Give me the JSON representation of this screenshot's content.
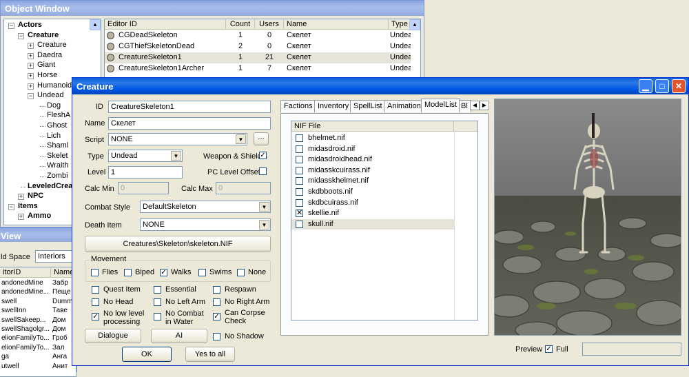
{
  "object_window": {
    "title": "Object Window",
    "tree": [
      {
        "label": "Actors",
        "level": 0,
        "sign": "-",
        "bold": true
      },
      {
        "label": "Creature",
        "level": 1,
        "sign": "-",
        "bold": true
      },
      {
        "label": "Creature",
        "level": 2,
        "sign": "+"
      },
      {
        "label": "Daedra",
        "level": 2,
        "sign": "+"
      },
      {
        "label": "Giant",
        "level": 2,
        "sign": "+"
      },
      {
        "label": "Horse",
        "level": 2,
        "sign": "+"
      },
      {
        "label": "Humanoid",
        "level": 2,
        "sign": "+"
      },
      {
        "label": "Undead",
        "level": 2,
        "sign": "-"
      },
      {
        "label": "Dog",
        "level": 3
      },
      {
        "label": "FleshA",
        "level": 3
      },
      {
        "label": "Ghost",
        "level": 3
      },
      {
        "label": "Lich",
        "level": 3
      },
      {
        "label": "Shaml",
        "level": 3
      },
      {
        "label": "Skelet",
        "level": 3
      },
      {
        "label": "Wraith",
        "level": 3
      },
      {
        "label": "Zombi",
        "level": 3
      },
      {
        "label": "LeveledCrea",
        "level": 1,
        "bold": true
      },
      {
        "label": "NPC",
        "level": 1,
        "sign": "+",
        "bold": true
      },
      {
        "label": "Items",
        "level": 0,
        "sign": "-",
        "bold": true
      },
      {
        "label": "Ammo",
        "level": 1,
        "sign": "+",
        "bold": true
      }
    ],
    "columns": [
      "Editor ID",
      "Count",
      "Users",
      "Name",
      "Type"
    ],
    "rows": [
      {
        "id": "CGDeadSkeleton",
        "count": "1",
        "users": "0",
        "name": "Скелет",
        "type": "Undea"
      },
      {
        "id": "CGThiefSkeletonDead",
        "count": "2",
        "users": "0",
        "name": "Скелет",
        "type": "Undea"
      },
      {
        "id": "CreatureSkeleton1",
        "count": "1",
        "users": "21",
        "name": "Скелет",
        "type": "Undea"
      },
      {
        "id": "CreatureSkeleton1Archer",
        "count": "1",
        "users": "7",
        "name": "Скелет",
        "type": "Undea"
      }
    ]
  },
  "cell_view": {
    "title": "View",
    "space_label": "ld Space",
    "space_value": "Interiors",
    "columns": [
      "itorID",
      "Name"
    ],
    "rows": [
      [
        "andonedMine",
        "Забр"
      ],
      [
        "andonedMine...",
        "Пеще"
      ],
      [
        "swell",
        "Dumm"
      ],
      [
        "swellInn",
        "Таве"
      ],
      [
        "swellSakeep...",
        "Дом"
      ],
      [
        "swellShagolgr...",
        "Дом"
      ],
      [
        "elionFamilyTo...",
        "Гроб"
      ],
      [
        "elionFamilyTo...",
        "Зал"
      ],
      [
        "ga",
        "Анга"
      ],
      [
        "utwell",
        "Анит"
      ]
    ]
  },
  "creature": {
    "title": "Creature",
    "id_label": "ID",
    "id_value": "CreatureSkeleton1",
    "name_label": "Name",
    "name_value": "Скелет",
    "script_label": "Script",
    "script_value": "NONE",
    "script_btn": "...",
    "type_label": "Type",
    "type_value": "Undead",
    "weapon_shield_label": "Weapon & Shield",
    "level_label": "Level",
    "level_value": "1",
    "pc_level_label": "PC Level Offset",
    "calc_min_label": "Calc Min",
    "calc_min_value": "0",
    "calc_max_label": "Calc Max",
    "calc_max_value": "0",
    "combat_style_label": "Combat Style",
    "combat_style_value": "DefaultSkeleton",
    "death_item_label": "Death Item",
    "death_item_value": "NONE",
    "model_path": "Creatures\\Skeleton\\skeleton.NIF",
    "movement_label": "Movement",
    "movement": [
      {
        "label": "Flies",
        "checked": false
      },
      {
        "label": "Biped",
        "checked": false
      },
      {
        "label": "Walks",
        "checked": true
      },
      {
        "label": "Swims",
        "checked": false
      },
      {
        "label": "None",
        "checked": false
      }
    ],
    "flags": {
      "quest_item": "Quest Item",
      "essential": "Essential",
      "respawn": "Respawn",
      "no_head": "No Head",
      "no_left_arm": "No Left Arm",
      "no_right_arm": "No Right Arm",
      "no_low_level_1": "No low level",
      "no_low_level_2": "processing",
      "no_combat_1": "No Combat",
      "no_combat_2": "in Water",
      "can_corpse_1": "Can Corpse",
      "can_corpse_2": "Check",
      "no_shadow": "No Shadow"
    },
    "dialogue_btn": "Dialogue",
    "ai_btn": "AI",
    "ok_btn": "OK",
    "yes_to_all_btn": "Yes to all",
    "tabs": [
      "Factions",
      "Inventory",
      "SpellList",
      "Animation",
      "ModelList",
      "Bl"
    ],
    "nif_header": "NIF File",
    "nif_files": [
      {
        "file": "bhelmet.nif",
        "mark": ""
      },
      {
        "file": "midasdroid.nif",
        "mark": ""
      },
      {
        "file": "midasdroidhead.nif",
        "mark": ""
      },
      {
        "file": "midasskcuirass.nif",
        "mark": ""
      },
      {
        "file": "midasskhelmet.nif",
        "mark": ""
      },
      {
        "file": "skdbboots.nif",
        "mark": ""
      },
      {
        "file": "skdbcuirass.nif",
        "mark": ""
      },
      {
        "file": "skellie.nif",
        "mark": "x"
      },
      {
        "file": "skull.nif",
        "mark": ""
      }
    ],
    "preview_label": "Preview",
    "full_label": "Full"
  },
  "colors": {
    "title_active": "#0055e5",
    "title_inactive": "#a9bde9",
    "window_bg": "#ece9d8",
    "selection_bg": "#e6e4d8"
  }
}
